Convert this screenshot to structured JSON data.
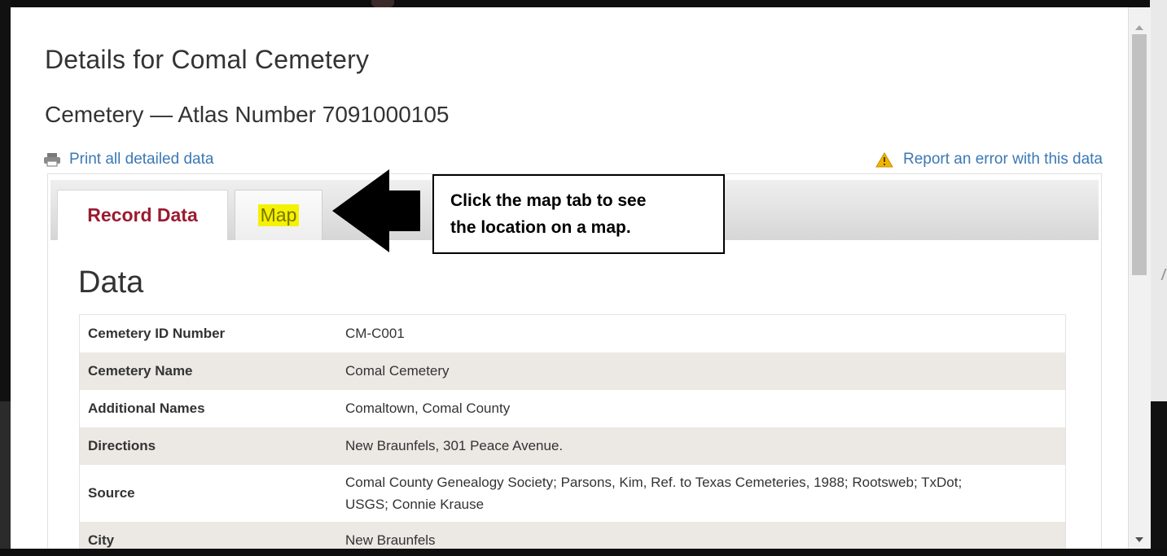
{
  "dialog": {
    "title": "Details for Comal Cemetery",
    "subtitle": "Cemetery — Atlas Number 7091000105"
  },
  "actions": {
    "print_label": "Print all detailed data",
    "report_label": "Report an error with this data"
  },
  "tabs": [
    {
      "label": "Record Data",
      "active": true
    },
    {
      "label": "Map",
      "active": false,
      "highlight_color": "#f4f200"
    }
  ],
  "callout": {
    "line1": "Click the map tab to see",
    "line2": "the location on a map."
  },
  "section": {
    "heading": "Data"
  },
  "rows": [
    {
      "label": "Cemetery ID Number",
      "value": "CM-C001"
    },
    {
      "label": "Cemetery Name",
      "value": "Comal Cemetery"
    },
    {
      "label": "Additional Names",
      "value": "Comaltown, Comal County"
    },
    {
      "label": "Directions",
      "value": "New Braunfels, 301 Peace Avenue."
    },
    {
      "label": "Source",
      "value_line1": "Comal County Genealogy Society; Parsons, Kim, Ref. to Texas Cemeteries, 1988; Rootsweb; TxDot;",
      "value_line2": "USGS; Connie Krause"
    },
    {
      "label": "City",
      "value": "New Braunfels"
    }
  ],
  "colors": {
    "link": "#3b78b5",
    "active_tab_text": "#9b1b30",
    "row_stripe": "#ece8e4",
    "warning": "#f0b400"
  },
  "icons": {
    "print": "printer-icon",
    "report": "warning-triangle-icon",
    "callout_arrow": "left-arrow-icon"
  }
}
